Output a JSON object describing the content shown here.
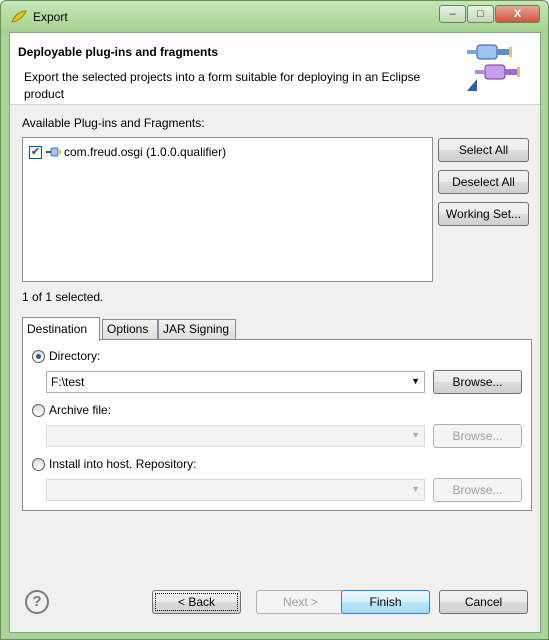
{
  "window": {
    "title": "Export",
    "controls": {
      "minimize": "–",
      "maximize": "□",
      "close": "X"
    }
  },
  "banner": {
    "title": "Deployable plug-ins and fragments",
    "description": "Export the selected projects into a form suitable for deploying in an Eclipse product"
  },
  "plugins": {
    "label": "Available Plug-ins and Fragments:",
    "items": [
      {
        "label": "com.freud.osgi (1.0.0.qualifier)",
        "checked": true
      }
    ],
    "status": "1 of 1 selected."
  },
  "side_buttons": {
    "select_all": "Select All",
    "deselect_all": "Deselect All",
    "working_set": "Working Set..."
  },
  "tabs": [
    "Destination",
    "Options",
    "JAR Signing"
  ],
  "destination": {
    "directory_label": "Directory:",
    "directory_value": "F:\\test",
    "archive_label": "Archive file:",
    "archive_value": "",
    "install_label": "Install into host. Repository:",
    "install_value": "",
    "browse": "Browse..."
  },
  "footer": {
    "back": "< Back",
    "next": "Next >",
    "finish": "Finish",
    "cancel": "Cancel",
    "help": "?"
  },
  "colors": {
    "frame": "#a9d49a",
    "client": "#f0f0f0",
    "primary_button": "#a7d9f5"
  }
}
